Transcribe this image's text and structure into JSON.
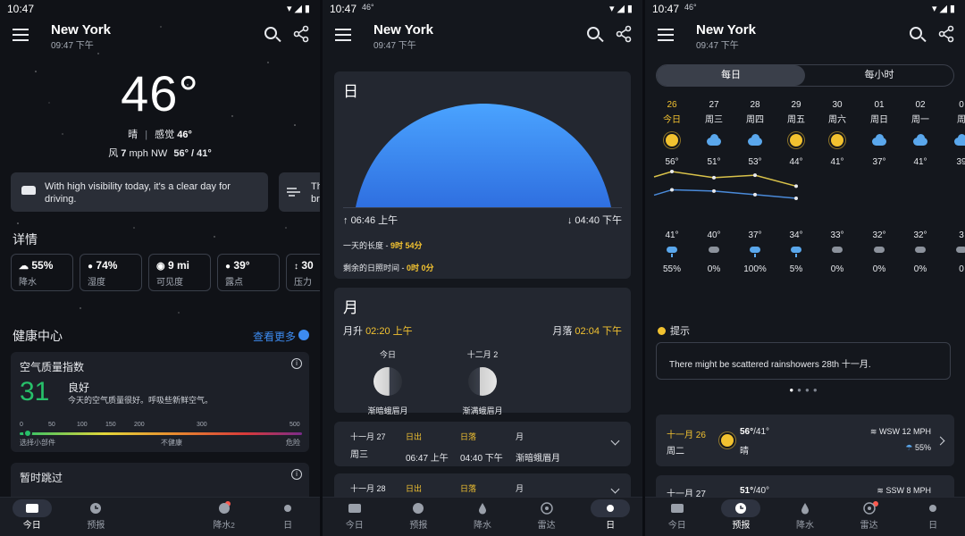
{
  "status": {
    "time": "10:47",
    "deg": "46°"
  },
  "header": {
    "city": "New York",
    "time": "09:47 下午"
  },
  "nav": [
    "今日",
    "预报",
    "降水",
    "雷达",
    "日"
  ],
  "nav_s1": [
    "今日",
    "预报",
    "降水",
    "日"
  ],
  "nav_s1_partial": "2",
  "today": {
    "temp": "46°",
    "cond": "晴",
    "sep": "|",
    "feels_label": "感觉",
    "feels_value": "46°",
    "wind_label": "风",
    "wind_value": "7",
    "wind_unit": "mph NW",
    "hilo": "56° / 41°",
    "drive_tip": "With high visibility today, it's a clear day for driving.",
    "drive_tip2": "Th br",
    "details_title": "详情",
    "details": [
      {
        "value": "55%",
        "label": "降水"
      },
      {
        "value": "74%",
        "label": "湿度"
      },
      {
        "value": "9 mi",
        "label": "可见度"
      },
      {
        "value": "39°",
        "label": "露点"
      },
      {
        "value": "30",
        "label": "压力"
      }
    ],
    "health_title": "健康中心",
    "see_more": "查看更多",
    "aqi": {
      "title": "空气质量指数",
      "value": "31",
      "level": "良好",
      "desc": "今天的空气质量很好。呼吸些新鲜空气。",
      "ticks": [
        "0",
        "50",
        "100",
        "150",
        "200",
        "300",
        "500"
      ],
      "scale_labels": [
        "选择小部件",
        "不健康",
        "危险"
      ]
    },
    "skip_title": "暂时跳过"
  },
  "sun": {
    "title": "日",
    "rise": "06:46 上午",
    "set": "04:40 下午",
    "day_length_label": "一天的长度 -",
    "day_length": "9时 54分",
    "remaining_label": "剩余的日照时间 -",
    "remaining": "0时 0分"
  },
  "moon": {
    "title": "月",
    "rise_label": "月升",
    "rise": "02:20 上午",
    "set_label": "月落",
    "set": "02:04 下午",
    "phases": [
      {
        "day": "今日",
        "name": "渐暗蛾眉月"
      },
      {
        "day": "十二月 2",
        "name": "渐满蛾眉月"
      }
    ]
  },
  "astro_rows": [
    {
      "date": "十一月 27",
      "dow": "周三",
      "rise_label": "日出",
      "rise": "06:47 上午",
      "set_label": "日落",
      "set": "04:40 下午",
      "moon_label": "月",
      "moon": "渐暗蛾眉月"
    },
    {
      "date": "十一月 28",
      "dow": "",
      "rise_label": "日出",
      "rise": "",
      "set_label": "日落",
      "set": "",
      "moon_label": "月",
      "moon": ""
    }
  ],
  "forecast": {
    "tabs": [
      "每日",
      "每小时"
    ],
    "days": [
      {
        "date": "26",
        "dow": "今日",
        "icon": "sun-icon",
        "hi": "56°",
        "lo": "41°",
        "pct": "55%"
      },
      {
        "date": "27",
        "dow": "周三",
        "icon": "cloud-icon",
        "hi": "51°",
        "lo": "40°",
        "pct": "0%"
      },
      {
        "date": "28",
        "dow": "周四",
        "icon": "cloud-icon",
        "hi": "53°",
        "lo": "37°",
        "pct": "100%"
      },
      {
        "date": "29",
        "dow": "周五",
        "icon": "sun-icon",
        "hi": "44°",
        "lo": "34°",
        "pct": "5%"
      },
      {
        "date": "30",
        "dow": "周六",
        "icon": "sun-icon",
        "hi": "41°",
        "lo": "33°",
        "pct": "0%"
      },
      {
        "date": "01",
        "dow": "周日",
        "icon": "cloud-icon",
        "hi": "37°",
        "lo": "32°",
        "pct": "0%"
      },
      {
        "date": "02",
        "dow": "周一",
        "icon": "cloud-icon",
        "hi": "41°",
        "lo": "32°",
        "pct": "0%"
      },
      {
        "date": "0",
        "dow": "周",
        "icon": "cloud-icon",
        "hi": "39",
        "lo": "3",
        "pct": "0"
      }
    ],
    "tip_title": "提示",
    "tip_text": "There might be scattered rainshowers 28th 十一月.",
    "cards": [
      {
        "date": "十一月 26",
        "dow": "周二",
        "temp_hi": "56°",
        "temp_lo": "/41°",
        "cond": "晴",
        "wind": "WSW 12 MPH",
        "rain": "55%"
      },
      {
        "date": "十一月 27",
        "dow": "",
        "temp_hi": "51°",
        "temp_lo": "/40°",
        "cond": "",
        "wind": "SSW 8 MPH",
        "rain": ""
      }
    ]
  },
  "colors": {
    "accent_blue": "#3d8bf0",
    "highlight_yellow": "#f2c230",
    "aqi_good": "#27c06a"
  }
}
